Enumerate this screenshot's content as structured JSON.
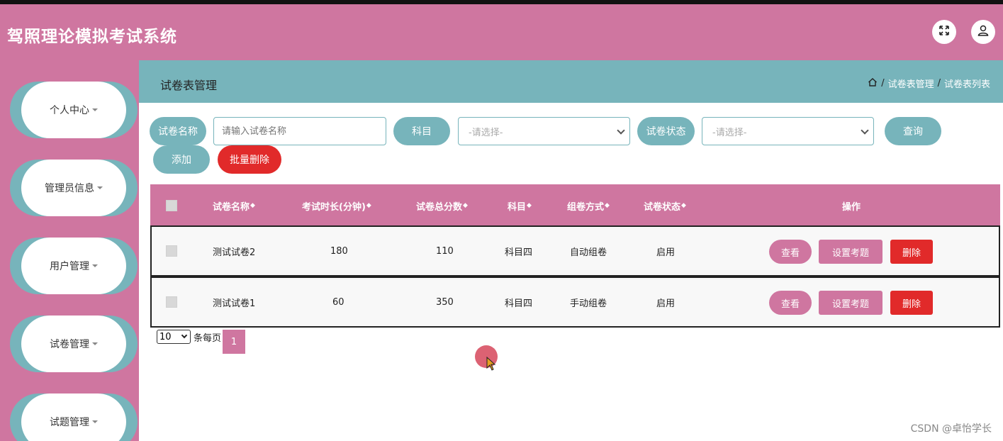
{
  "app": {
    "title": "驾照理论模拟考试系统"
  },
  "header": {
    "fullscreen_icon": "expand-icon",
    "user_icon": "user-icon"
  },
  "sidebar": {
    "items": [
      {
        "label": "个人中心"
      },
      {
        "label": "管理员信息"
      },
      {
        "label": "用户管理"
      },
      {
        "label": "试卷管理"
      },
      {
        "label": "试题管理"
      }
    ]
  },
  "page": {
    "title": "试卷表管理",
    "breadcrumb": [
      "试卷表管理",
      "试卷表列表"
    ],
    "breadcrumb_sep": "/"
  },
  "search": {
    "name_label": "试卷名称",
    "name_placeholder": "请输入试卷名称",
    "subject_label": "科目",
    "subject_value": "-请选择-",
    "status_label": "试卷状态",
    "status_value": "-请选择-",
    "query_button": "查询",
    "add_button": "添加",
    "batch_delete_button": "批量删除"
  },
  "table": {
    "headers": [
      "试卷名称",
      "考试时长(分钟)",
      "试卷总分数",
      "科目",
      "组卷方式",
      "试卷状态",
      "操作"
    ],
    "sort_glyph": "◆",
    "rows": [
      {
        "name": "测试试卷2",
        "duration": "180",
        "score": "110",
        "subject": "科目四",
        "method": "自动组卷",
        "status": "启用"
      },
      {
        "name": "测试试卷1",
        "duration": "60",
        "score": "350",
        "subject": "科目四",
        "method": "手动组卷",
        "status": "启用"
      }
    ],
    "actions": {
      "view": "查看",
      "set": "设置考题",
      "delete": "删除"
    }
  },
  "pagination": {
    "page_size": "10",
    "per_page_label": "条每页",
    "current_page": "1"
  },
  "watermark": "CSDN @卓怡学长",
  "colors": {
    "pink": "#cf76a0",
    "teal": "#77b4bb",
    "red": "#e12a2a"
  }
}
